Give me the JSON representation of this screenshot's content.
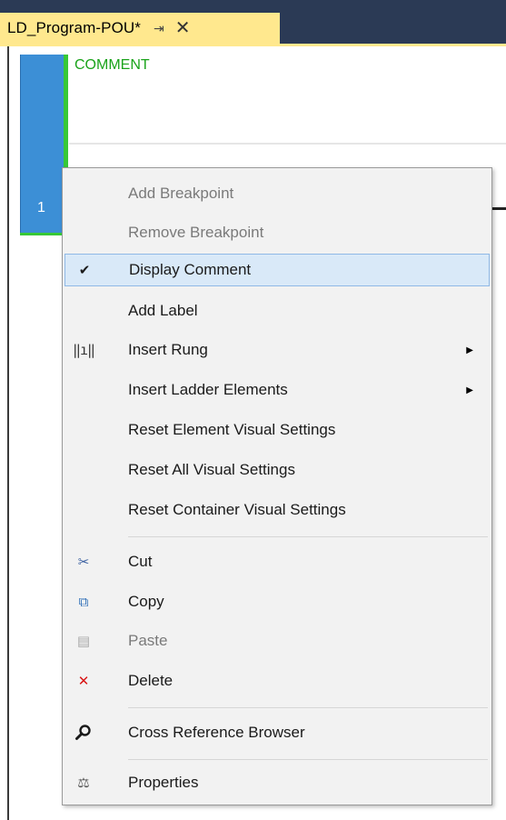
{
  "tab": {
    "title": "LD_Program-POU*",
    "pin": "⇥",
    "close": "✕"
  },
  "editor": {
    "comment": "COMMENT",
    "rung_number": "1"
  },
  "menu": {
    "items": [
      {
        "label": "Add Breakpoint",
        "disabled": true
      },
      {
        "label": "Remove Breakpoint",
        "disabled": true
      },
      {
        "label": "Display Comment",
        "checked": true,
        "selected": true
      },
      {
        "label": "Add Label"
      },
      {
        "label": "Insert Rung",
        "icon": "rung-icon",
        "submenu": true
      },
      {
        "label": "Insert Ladder Elements",
        "submenu": true
      },
      {
        "label": "Reset Element Visual Settings"
      },
      {
        "label": "Reset All Visual Settings"
      },
      {
        "label": "Reset Container Visual Settings"
      },
      {
        "label": "Cut",
        "icon": "scissors-icon"
      },
      {
        "label": "Copy",
        "icon": "copy-icon"
      },
      {
        "label": "Paste",
        "icon": "paste-icon",
        "disabled": true
      },
      {
        "label": "Delete",
        "icon": "delete-icon"
      },
      {
        "label": "Cross Reference Browser",
        "icon": "search-icon"
      },
      {
        "label": "Properties",
        "icon": "properties-icon"
      }
    ],
    "glyphs": {
      "check": "✔",
      "rung": "‖ı‖",
      "cut": "✂",
      "copy": "⧉",
      "paste": "▤",
      "delete": "✕",
      "search": "⌕",
      "properties": "⚖",
      "arrow": "▶"
    }
  },
  "colors": {
    "titlebar": "#2b3a55",
    "tab": "#ffe88e",
    "rung_marker": "#3c8fd6",
    "comment_green": "#37c837",
    "menu_bg": "#f2f2f2",
    "menu_selected": "#d9e9f8"
  }
}
